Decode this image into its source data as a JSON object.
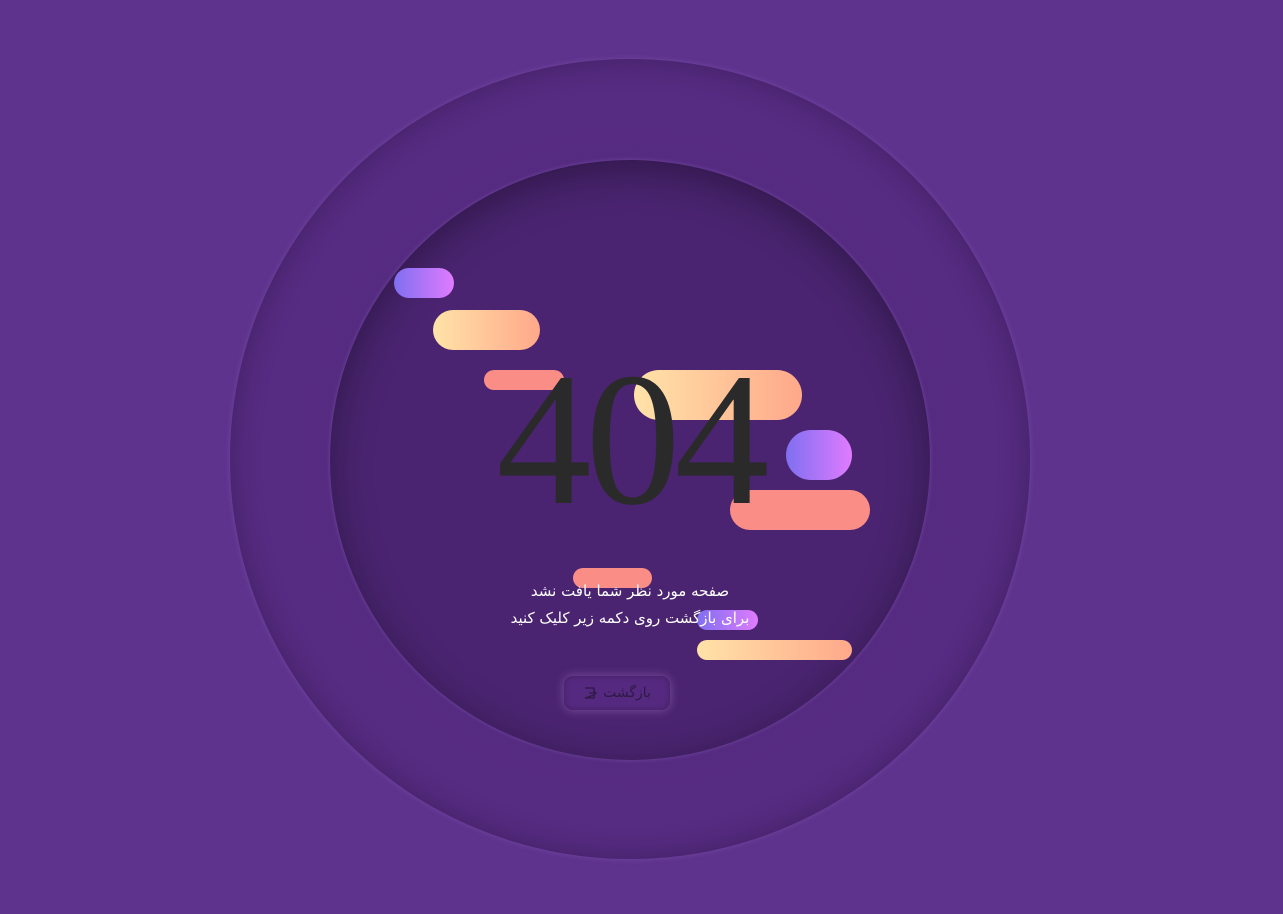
{
  "error": {
    "code": "404",
    "message_line_1": "صفحه مورد نظر شما یافت نشد",
    "message_line_2": "برای بازگشت روی دکمه زیر کلیک کنید"
  },
  "back_button": {
    "label": "بازگشت",
    "icon": "exit-icon"
  },
  "colors": {
    "background": "#5e338d",
    "circle_outer": "#562b82",
    "circle_inner": "#4a2470",
    "pill_purple_start": "#7f6ff0",
    "pill_purple_end": "#e07bff",
    "pill_cream_start": "#ffe3a8",
    "pill_cream_end": "#ffa88a",
    "pill_salmon": "#fb8d87",
    "text_404": "#2a2a2a"
  }
}
